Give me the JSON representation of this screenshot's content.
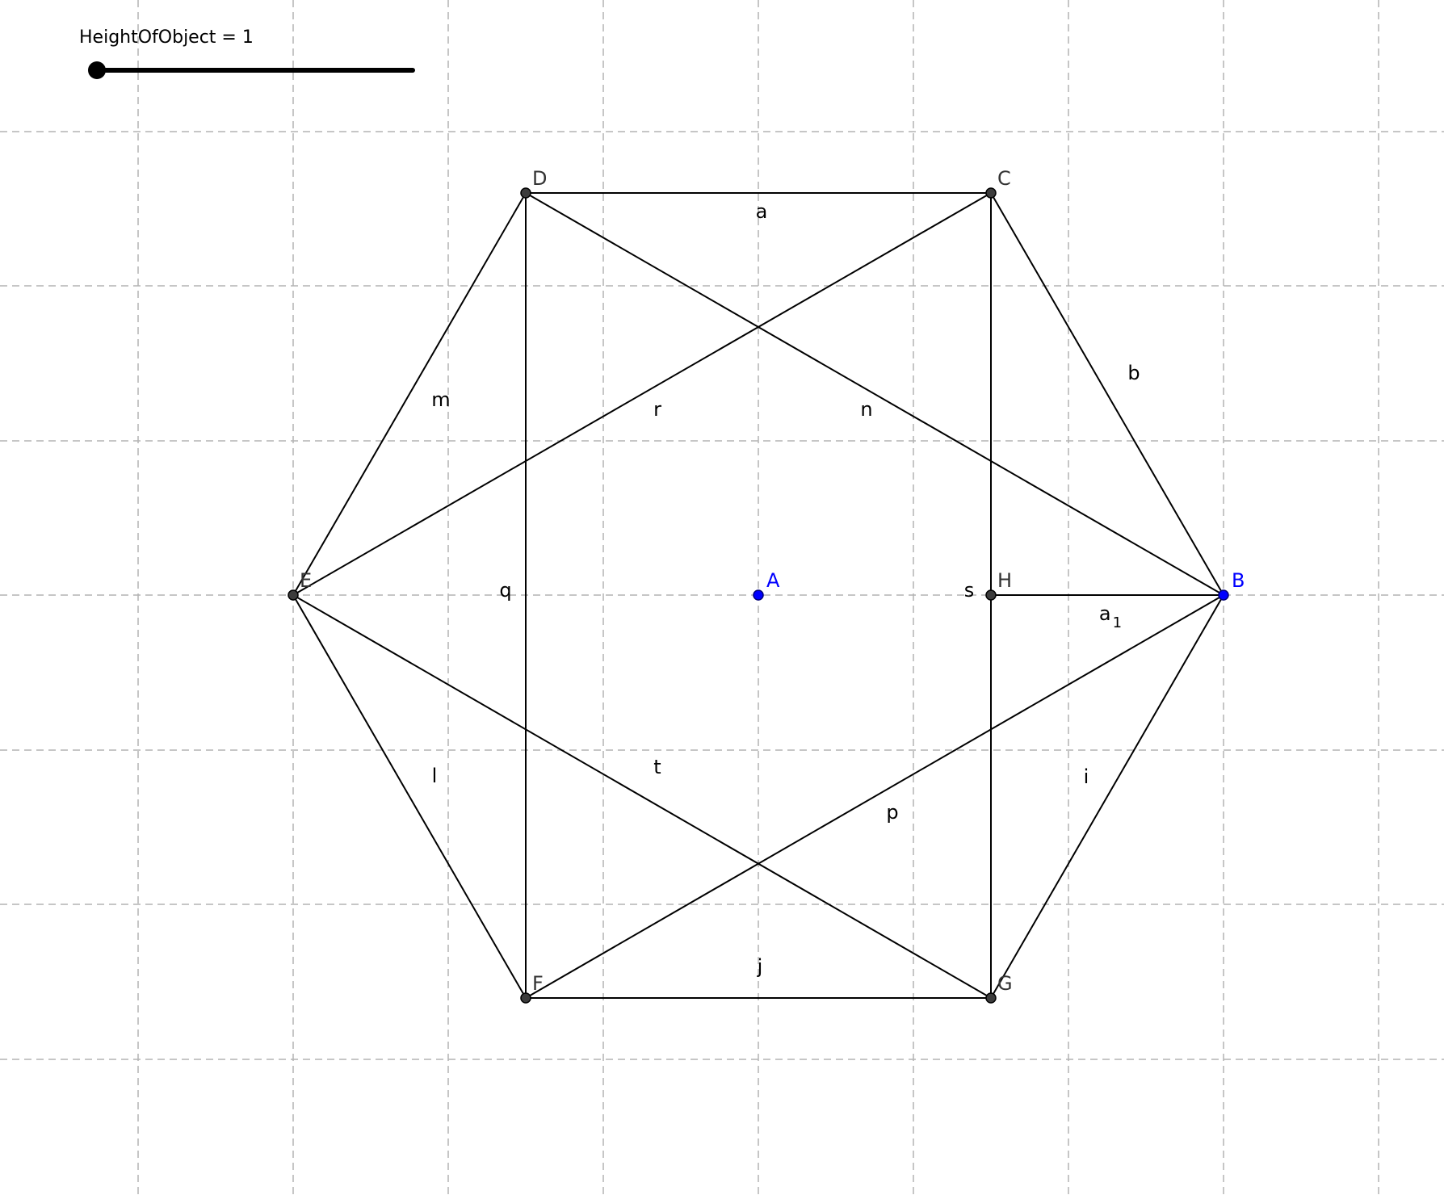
{
  "slider": {
    "name": "HeightOfObject",
    "value": "1",
    "caption": "HeightOfObject = 1",
    "fraction": 0
  },
  "colors": {
    "grid": "#b4b4b4",
    "segment": "#000000",
    "point": "#3c3c3c",
    "free_point": "#0000ff"
  },
  "points": [
    {
      "id": "A",
      "label": "A",
      "free": true
    },
    {
      "id": "B",
      "label": "B",
      "free": true
    },
    {
      "id": "C",
      "label": "C",
      "free": false
    },
    {
      "id": "D",
      "label": "D",
      "free": false
    },
    {
      "id": "E",
      "label": "E",
      "free": false
    },
    {
      "id": "F",
      "label": "F",
      "free": false
    },
    {
      "id": "G",
      "label": "G",
      "free": false
    },
    {
      "id": "H",
      "label": "H",
      "free": false
    }
  ],
  "segments": [
    {
      "name": "a",
      "from": "D",
      "to": "C"
    },
    {
      "name": "b",
      "from": "C",
      "to": "B"
    },
    {
      "name": "i",
      "from": "B",
      "to": "G"
    },
    {
      "name": "j",
      "from": "F",
      "to": "G"
    },
    {
      "name": "l",
      "from": "E",
      "to": "F"
    },
    {
      "name": "m",
      "from": "D",
      "to": "E"
    },
    {
      "name": "n",
      "from": "D",
      "to": "B"
    },
    {
      "name": "r",
      "from": "C",
      "to": "E"
    },
    {
      "name": "t",
      "from": "E",
      "to": "G"
    },
    {
      "name": "p",
      "from": "F",
      "to": "B"
    },
    {
      "name": "q",
      "from": "D",
      "to": "F"
    },
    {
      "name": "s",
      "from": "C",
      "to": "G"
    },
    {
      "name": "a",
      "sub": "1",
      "from": "H",
      "to": "B"
    }
  ]
}
